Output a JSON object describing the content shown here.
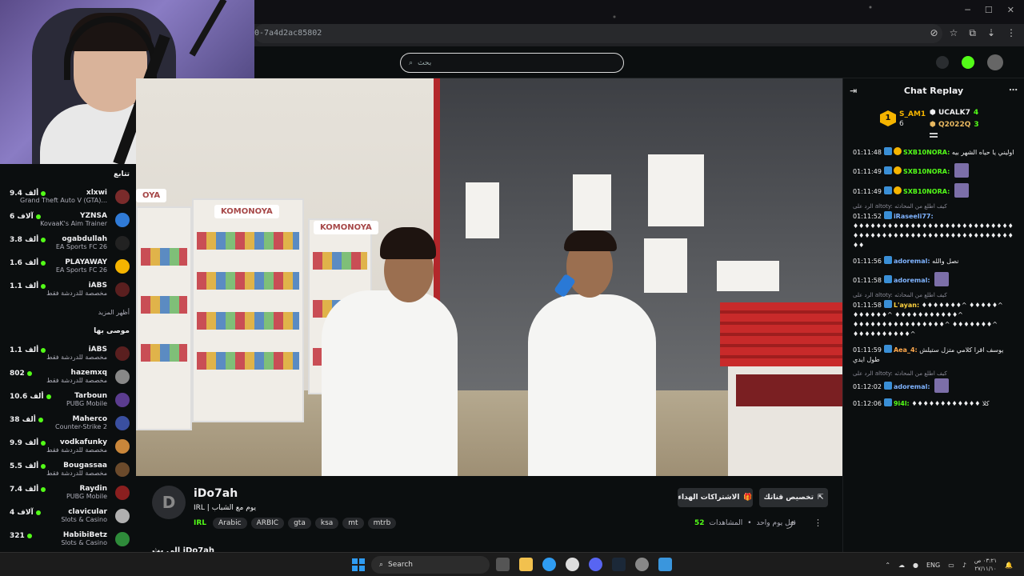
{
  "browser": {
    "url": "0-7a4d2ac85802"
  },
  "nav": {
    "search_placeholder": "بحث"
  },
  "sidebar": {
    "heading_top": "تتابع",
    "followed": [
      {
        "name": "xlxwi",
        "category": "Grand Theft Auto V (GTA)...",
        "viewers": "9.4 ألف",
        "avatar_color": "#7a2b2b"
      },
      {
        "name": "YZNSA",
        "category": "KovaaK's Aim Trainer",
        "viewers": "6 آلاف",
        "avatar_color": "#2f7ad6"
      },
      {
        "name": "ogabdullah",
        "category": "EA Sports FC 26",
        "viewers": "3.8 ألف",
        "avatar_color": "#222"
      },
      {
        "name": "PLAYAWAY",
        "category": "EA Sports FC 26",
        "viewers": "1.6 ألف",
        "avatar_color": "#f5b400"
      },
      {
        "name": "iABS",
        "category": "مخصصة للدردشة فقط",
        "viewers": "1.1 ألف",
        "avatar_color": "#5a1f1f"
      }
    ],
    "show_more": "أظهر المزيد",
    "heading_recommended": "موصى بها",
    "recommended": [
      {
        "name": "iABS",
        "category": "مخصصة للدردشة فقط",
        "viewers": "1.1 ألف",
        "avatar_color": "#5a1f1f"
      },
      {
        "name": "hazemxq",
        "category": "مخصصة للدردشة فقط",
        "viewers": "802",
        "avatar_color": "#888"
      },
      {
        "name": "Tarboun",
        "category": "PUBG Mobile",
        "viewers": "10.6 ألف",
        "avatar_color": "#5b3c8f"
      },
      {
        "name": "Maherco",
        "category": "Counter-Strike 2",
        "viewers": "38 ألف",
        "avatar_color": "#3a4fa0"
      },
      {
        "name": "vodkafunky",
        "category": "مخصصة للدردشة فقط",
        "viewers": "9.9 ألف",
        "avatar_color": "#c9863a"
      },
      {
        "name": "Bougassaa",
        "category": "مخصصة للدردشة فقط",
        "viewers": "5.5 ألف",
        "avatar_color": "#6b4a2b"
      },
      {
        "name": "Raydin",
        "category": "PUBG Mobile",
        "viewers": "7.4 ألف",
        "avatar_color": "#8a1f1f"
      },
      {
        "name": "clavicular",
        "category": "Slots & Casino",
        "viewers": "4 آلاف",
        "avatar_color": "#b0b0b0"
      },
      {
        "name": "HabibiBetz",
        "category": "Slots & Casino",
        "viewers": "321",
        "avatar_color": "#2e8b3a"
      }
    ]
  },
  "video": {
    "signs": [
      "KOMONOYA",
      "KOMONOYA",
      "OYA"
    ]
  },
  "chat": {
    "title": "Chat Replay",
    "leaders": {
      "first": {
        "rank": "1",
        "name": "S_AM1",
        "count": "6"
      },
      "second": {
        "name": "UCALK7",
        "count": "4"
      },
      "third": {
        "name": "Q2022Q",
        "count": "3"
      }
    },
    "messages": [
      {
        "time": "01:11:48",
        "user": "SXB10NORA:",
        "user_class": "u-green",
        "text": "اوليني يا حياه الشهر بيه",
        "gold": true,
        "emote": false,
        "reply": ""
      },
      {
        "time": "01:11:49",
        "user": "SXB10NORA:",
        "user_class": "u-green",
        "text": "",
        "gold": true,
        "emote": true,
        "reply": ""
      },
      {
        "time": "01:11:49",
        "user": "SXB10NORA:",
        "user_class": "u-green",
        "text": "",
        "gold": true,
        "emote": true,
        "reply": ""
      },
      {
        "time": "01:11:52",
        "user": "iRaseeli77:",
        "user_class": "u-blue",
        "text": "♦♦♦♦♦♦♦♦♦♦♦♦♦♦♦♦♦♦♦♦♦♦♦♦♦♦♦♦♦♦♦♦♦♦♦♦♦♦♦♦♦♦♦♦♦♦♦♦♦♦♦♦♦♦♦♦♦♦",
        "gold": false,
        "emote": false,
        "reply": "الرد على altoty: كيف اطلع من المحادثه"
      },
      {
        "time": "01:11:56",
        "user": "adoremal:",
        "user_class": "u-blue",
        "text": "نصل والله",
        "gold": false,
        "emote": false,
        "reply": ""
      },
      {
        "time": "01:11:58",
        "user": "adoremal:",
        "user_class": "u-blue",
        "text": "",
        "gold": false,
        "emote": true,
        "reply": ""
      },
      {
        "time": "01:11:58",
        "user": "L'ayan:",
        "user_class": "u-yellow",
        "text": "♦♦♦♦♦♦♦^ ♦♦♦♦♦^ ♦♦♦♦♦♦^ ♦♦♦♦♦♦♦♦♦♦♦^ ♦♦♦♦♦♦♦♦♦♦♦♦♦♦♦♦^ ♦♦♦♦♦♦♦^ ♦♦♦♦♦♦♦♦♦♦^",
        "gold": false,
        "emote": false,
        "reply": "الرد على altoty: كيف اطلع من المحادثه"
      },
      {
        "time": "01:11:59",
        "user": "Aea_4:",
        "user_class": "u-orange",
        "text": "يوسف اقرا كلامي متزل ستيلش طول ايدي",
        "gold": false,
        "emote": false,
        "reply": ""
      },
      {
        "time": "01:12:02",
        "user": "adoremal:",
        "user_class": "u-blue",
        "text": "",
        "gold": false,
        "emote": true,
        "reply": "الرد على altoty: كيف اطلع من المحادثه"
      },
      {
        "time": "01:12:06",
        "user": "9i4l:",
        "user_class": "u-green",
        "text": "♦♦♦♦♦♦♦♦♦♦♦♦ كلا",
        "gold": false,
        "emote": false,
        "reply": ""
      }
    ]
  },
  "stream": {
    "avatar_letter": "D",
    "streamer": "iDo7ah",
    "title": "IRL | يوم مع الشباب",
    "category": "IRL",
    "tags": [
      "Arabic",
      "ARBIC",
      "gta",
      "ksa",
      "mt",
      "mtrb"
    ],
    "subs_button": "الاشتراكات الهداء",
    "custom_button": "تخصيص قناتك",
    "time_ago": "قبل يوم واحد",
    "views_label": "المشاهدات",
    "views": "52",
    "below_text": "إلى بث iDo7ah"
  },
  "taskbar": {
    "search_label": "Search",
    "lang": "ENG",
    "time": "٠٣:٢١ ص",
    "date": "٢٧/١١/١٠"
  },
  "colors": {
    "accent": "#53fc18",
    "background": "#0b0e0f"
  }
}
